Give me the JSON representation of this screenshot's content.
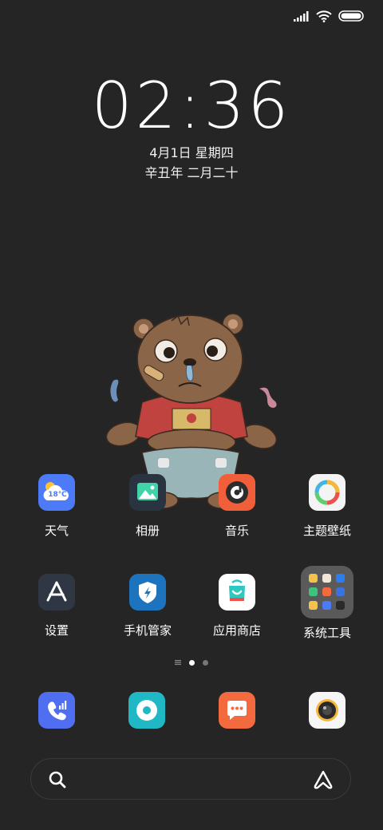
{
  "status_bar": {
    "icons": [
      "signal-icon",
      "wifi-icon",
      "battery-icon"
    ],
    "battery_level": 1.0
  },
  "lock": {
    "time": "02:36",
    "date": "4月1日 星期四",
    "lunar_date": "辛丑年 二月二十"
  },
  "home": {
    "row1": [
      {
        "label": "天气",
        "icon": "weather-icon",
        "temp": "18℃"
      },
      {
        "label": "相册",
        "icon": "gallery-icon"
      },
      {
        "label": "音乐",
        "icon": "music-icon"
      },
      {
        "label": "主题壁纸",
        "icon": "themes-icon"
      }
    ],
    "row2": [
      {
        "label": "设置",
        "icon": "settings-icon"
      },
      {
        "label": "手机管家",
        "icon": "security-icon"
      },
      {
        "label": "应用商店",
        "icon": "app-store-icon"
      },
      {
        "label": "系统工具",
        "icon": "folder-icon"
      }
    ],
    "page_indicator": {
      "pages": 2,
      "current": 1,
      "has_minus_one": true
    }
  },
  "dock": [
    "phone-icon",
    "browser-icon",
    "messages-icon",
    "camera-icon"
  ],
  "search_bar": {
    "left_icon": "search-icon",
    "right_icon": "assistant-icon"
  },
  "colors": {
    "background": "#252525",
    "weather": "#4d7bf7",
    "music": "#f05f39",
    "settings": "#2f3744",
    "security": "#1e73be",
    "phone": "#4f6ff0",
    "browser": "#1fb8c4",
    "messages": "#f26a3e"
  }
}
